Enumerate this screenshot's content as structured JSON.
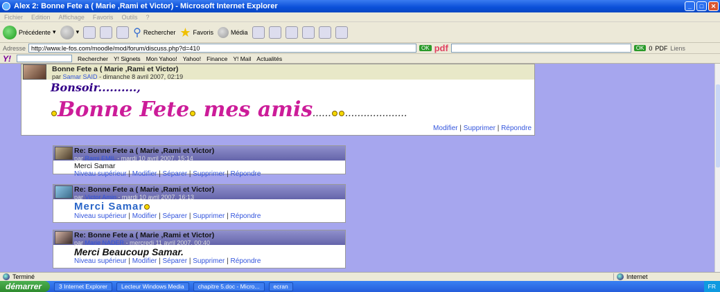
{
  "window": {
    "title": "Alex 2: Bonne Fete a ( Marie ,Rami et Victor) - Microsoft Internet Explorer"
  },
  "menu": [
    "Fichier",
    "Edition",
    "Affichage",
    "Favoris",
    "Outils",
    "?"
  ],
  "toolbar": {
    "back": "Précédente",
    "search": "Rechercher",
    "favorites": "Favoris",
    "media": "Média"
  },
  "address": {
    "label": "Adresse",
    "url": "http://www.le-fos.com/moodle/mod/forum/discuss.php?d=410",
    "go": "OK",
    "pdf_label": "pdf",
    "ok2": "OK",
    "count": "0",
    "pdf_btn": "PDF",
    "links": "Liens"
  },
  "yahoo": {
    "logo": "Y!",
    "search_btn": "Rechercher",
    "items": [
      "Y! Signets",
      "Mon Yahoo!",
      "Yahoo!",
      "Finance",
      "Y! Mail",
      "Actualités"
    ]
  },
  "main_post": {
    "subject": "Bonne Fete a ( Marie ,Rami et Victor)",
    "by_prefix": "par",
    "author": "Samar SAID",
    "date": "- dimanche 8 avril 2007, 02:19",
    "line1": "Bonsoir..........,",
    "line2a": "Bonne Fete",
    "line2b": " mes amis",
    "line2c": "......",
    "dots_tail": "....................",
    "cmd_edit": "Modifier",
    "cmd_delete": "Supprimer",
    "cmd_reply": "Répondre"
  },
  "replies": [
    {
      "subject": "Re: Bonne Fete a ( Marie ,Rami et Victor)",
      "author": "Rami EMIL",
      "date": "- mardi 10 avril 2007, 15:14",
      "message": "Merci Samar"
    },
    {
      "subject": "Re: Bonne Fete a ( Marie ,Rami et Victor)",
      "author": "Victor Amin",
      "date": "- mardi 10 avril 2007, 16:13",
      "message": "Merci Samar"
    },
    {
      "subject": "Re: Bonne Fete a ( Marie ,Rami et Victor)",
      "author": "Marie NADER",
      "date": "- mercredi 11 avril 2007, 00:40",
      "message": "Merci Beaucoup Samar."
    }
  ],
  "reply_cmds": {
    "up": "Niveau supérieur",
    "edit": "Modifier",
    "split": "Séparer",
    "delete": "Supprimer",
    "reply": "Répondre"
  },
  "status": {
    "text": "Terminé",
    "zone": "Internet"
  },
  "taskbar": {
    "start": "démarrer",
    "tasks": [
      "3 Internet Explorer",
      "Lecteur Windows Media",
      "chapitre 5.doc - Micro...",
      "ecran"
    ],
    "lang": "FR"
  }
}
